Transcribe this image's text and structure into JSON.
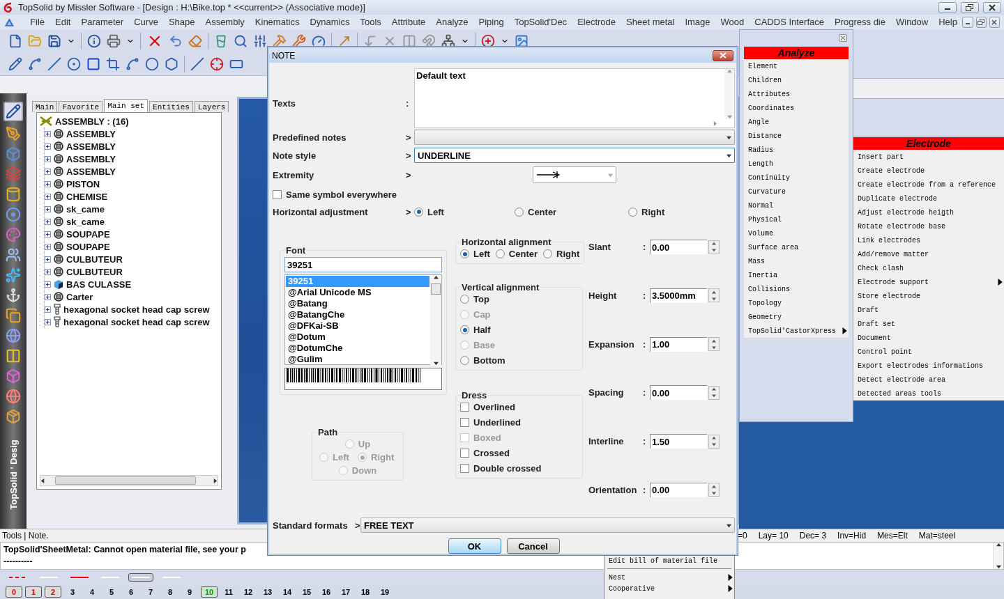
{
  "window": {
    "title": "TopSolid by Missler Software - [Design : H:\\Bike.top *  <<current>> (Associative mode)]"
  },
  "menu_bar": [
    "File",
    "Edit",
    "Parameter",
    "Curve",
    "Shape",
    "Assembly",
    "Kinematics",
    "Dynamics",
    "Tools",
    "Attribute",
    "Analyze",
    "Piping",
    "TopSolid'Dec",
    "Electrode",
    "Sheet metal",
    "Image",
    "Wood",
    "CADDS Interface",
    "Progress die",
    "Window",
    "Help"
  ],
  "sidebar_tabs": [
    {
      "label": "Main",
      "selected": false
    },
    {
      "label": "Favorite",
      "selected": false
    },
    {
      "label": "Main set",
      "selected": true
    },
    {
      "label": "Entities",
      "selected": false
    },
    {
      "label": "Layers",
      "selected": false
    }
  ],
  "side_logo": "TopSolid ' Desig",
  "tree": {
    "label": "ASSEMBLY : (16)",
    "children": [
      {
        "label": "ASSEMBLY",
        "kind": "part"
      },
      {
        "label": "ASSEMBLY",
        "kind": "part"
      },
      {
        "label": "ASSEMBLY",
        "kind": "part"
      },
      {
        "label": "ASSEMBLY",
        "kind": "part"
      },
      {
        "label": "PISTON",
        "kind": "part"
      },
      {
        "label": "CHEMISE",
        "kind": "part"
      },
      {
        "label": "sk_came",
        "kind": "part"
      },
      {
        "label": "sk_came",
        "kind": "part"
      },
      {
        "label": "SOUPAPE",
        "kind": "part"
      },
      {
        "label": "SOUPAPE",
        "kind": "part"
      },
      {
        "label": "CULBUTEUR",
        "kind": "part"
      },
      {
        "label": "CULBUTEUR",
        "kind": "part"
      },
      {
        "label": "BAS CULASSE",
        "kind": "solid"
      },
      {
        "label": "Carter",
        "kind": "part"
      },
      {
        "label": "hexagonal socket head cap screw",
        "kind": "screw"
      },
      {
        "label": "hexagonal socket head cap screw",
        "kind": "screw"
      }
    ]
  },
  "analyze_menu": {
    "title": "Analyze",
    "items": [
      {
        "label": "Element",
        "submenu": false
      },
      {
        "label": "Children",
        "submenu": false
      },
      {
        "label": "Attributes",
        "submenu": false
      },
      {
        "label": "Coordinates",
        "submenu": false
      },
      {
        "label": "Angle",
        "submenu": false
      },
      {
        "label": "Distance",
        "submenu": false
      },
      {
        "label": "Radius",
        "submenu": false
      },
      {
        "label": "Length",
        "submenu": false
      },
      {
        "label": "Continuity",
        "submenu": false
      },
      {
        "label": "Curvature",
        "submenu": false
      },
      {
        "label": "Normal",
        "submenu": false
      },
      {
        "label": "Physical",
        "submenu": false
      },
      {
        "label": "Volume",
        "submenu": false
      },
      {
        "label": "Surface area",
        "submenu": false
      },
      {
        "label": "Mass",
        "submenu": false
      },
      {
        "label": "Inertia",
        "submenu": false
      },
      {
        "label": "Collisions",
        "submenu": false
      },
      {
        "label": "Topology",
        "submenu": false
      },
      {
        "label": "Geometry",
        "submenu": false
      },
      {
        "label": "TopSolid'CastorXpress",
        "submenu": true
      }
    ]
  },
  "electrode_menu": {
    "title": "Electrode",
    "items": [
      {
        "label": "Insert part",
        "submenu": false
      },
      {
        "label": "Create electrode",
        "submenu": false
      },
      {
        "label": "Create electrode from a reference",
        "submenu": false
      },
      {
        "label": "Duplicate electrode",
        "submenu": false
      },
      {
        "label": "Adjust electrode heigth",
        "submenu": false
      },
      {
        "label": "Rotate electrode base",
        "submenu": false
      },
      {
        "label": "Link electrodes",
        "submenu": false
      },
      {
        "label": "Add/remove matter",
        "submenu": false
      },
      {
        "label": "Check clash",
        "submenu": false
      },
      {
        "label": "Electrode support",
        "submenu": true
      },
      {
        "label": "Store electrode",
        "submenu": false
      },
      {
        "label": "Draft",
        "submenu": false
      },
      {
        "label": "Draft set",
        "submenu": false
      },
      {
        "label": "Document",
        "submenu": false
      },
      {
        "label": "Control point",
        "submenu": false
      },
      {
        "label": "Export electrodes informations",
        "submenu": false
      },
      {
        "label": "Detect electrode area",
        "submenu": false
      },
      {
        "label": "Detected areas tools",
        "submenu": false
      }
    ]
  },
  "dialog": {
    "title": "NOTE",
    "texts": {
      "label": "Texts",
      "sep": ":",
      "value": "Default text"
    },
    "predefined_notes": {
      "label": "Predefined notes",
      "sep": ">"
    },
    "note_style": {
      "label": "Note style",
      "sep": ">",
      "value": "UNDERLINE"
    },
    "extremity": {
      "label": "Extremity",
      "sep": ">"
    },
    "same_symbol": {
      "label": "Same symbol everywhere",
      "checked": false
    },
    "horizontal_adjustment": {
      "label": "Horizontal adjustment",
      "sep": ">",
      "options": [
        {
          "label": "Left",
          "selected": true
        },
        {
          "label": "Center",
          "selected": false
        },
        {
          "label": "Right",
          "selected": false
        }
      ]
    },
    "font": {
      "label": "Font",
      "value": "39251",
      "options": [
        {
          "label": "39251",
          "selected": true
        },
        {
          "label": "@Arial Unicode MS",
          "selected": false
        },
        {
          "label": "@Batang",
          "selected": false
        },
        {
          "label": "@BatangChe",
          "selected": false
        },
        {
          "label": "@DFKai-SB",
          "selected": false
        },
        {
          "label": "@Dotum",
          "selected": false
        },
        {
          "label": "@DotumChe",
          "selected": false
        },
        {
          "label": "@Gulim",
          "selected": false
        }
      ]
    },
    "path": {
      "label": "Path",
      "options": [
        {
          "label": "Up",
          "selected": false,
          "disabled": true
        },
        {
          "label": "Left",
          "selected": false,
          "disabled": true
        },
        {
          "label": "Right",
          "selected": true,
          "disabled": true
        },
        {
          "label": "Down",
          "selected": false,
          "disabled": true
        }
      ]
    },
    "horizontal_alignment": {
      "label": "Horizontal alignment",
      "options": [
        {
          "label": "Left",
          "selected": true
        },
        {
          "label": "Center",
          "selected": false
        },
        {
          "label": "Right",
          "selected": false
        }
      ]
    },
    "vertical_alignment": {
      "label": "Vertical alignment",
      "options": [
        {
          "label": "Top",
          "selected": false,
          "disabled": false
        },
        {
          "label": "Cap",
          "selected": false,
          "disabled": true
        },
        {
          "label": "Half",
          "selected": true,
          "disabled": false
        },
        {
          "label": "Base",
          "selected": false,
          "disabled": true
        },
        {
          "label": "Bottom",
          "selected": false,
          "disabled": false
        }
      ]
    },
    "dress": {
      "label": "Dress",
      "options": [
        {
          "label": "Overlined",
          "checked": false,
          "disabled": false
        },
        {
          "label": "Underlined",
          "checked": false,
          "disabled": false
        },
        {
          "label": "Boxed",
          "checked": false,
          "disabled": true
        },
        {
          "label": "Crossed",
          "checked": false,
          "disabled": false
        },
        {
          "label": "Double crossed",
          "checked": false,
          "disabled": false
        }
      ]
    },
    "fields": [
      {
        "label": "Slant",
        "sep": ":",
        "value": "0.00"
      },
      {
        "label": "Height",
        "sep": ":",
        "value": "3.5000mm"
      },
      {
        "label": "Expansion",
        "sep": ":",
        "value": "1.00"
      },
      {
        "label": "Spacing",
        "sep": ":",
        "value": "0.00"
      },
      {
        "label": "Interline",
        "sep": ":",
        "value": "1.50"
      },
      {
        "label": "Orientation",
        "sep": ":",
        "value": "0.00"
      }
    ],
    "standard_formats": {
      "label": "Standard formats",
      "sep": ">",
      "value": "FREE TEXT"
    },
    "buttons": [
      {
        "label": "OK",
        "default": true
      },
      {
        "label": "Cancel",
        "default": false
      }
    ]
  },
  "status_bar": {
    "left": "Tools | Note.",
    "right": [
      "=0",
      "Lay= 10",
      "Dec= 3",
      "Inv=Hid",
      "Mes=Elt",
      "Mat=steel"
    ]
  },
  "messages": [
    "TopSolid'SheetMetal: Cannot open material file, see your p",
    "----------"
  ],
  "popup_menu": [
    {
      "label": "Edit bill of material file",
      "submenu": false
    },
    {
      "label": "Nest",
      "submenu": true
    },
    {
      "label": "Cooperative",
      "submenu": true
    }
  ],
  "line_styles": [
    {
      "color": "#ff0000",
      "dashed": true,
      "selected": false
    },
    {
      "color": "#ffffff",
      "dashed": false,
      "selected": false
    },
    {
      "color": "#ff0000",
      "dashed": false,
      "selected": false
    },
    {
      "color": "#ffffff",
      "dashed": false,
      "selected": false
    },
    {
      "color": "#ffffff",
      "dashed": false,
      "selected": true
    },
    {
      "color": "#ffffff",
      "dashed": false,
      "selected": false
    }
  ],
  "layers": [
    {
      "label": "0",
      "kind": "used"
    },
    {
      "label": "1",
      "kind": "used"
    },
    {
      "label": "2",
      "kind": "used"
    },
    {
      "label": "3",
      "kind": "empty"
    },
    {
      "label": "4",
      "kind": "empty"
    },
    {
      "label": "5",
      "kind": "empty"
    },
    {
      "label": "6",
      "kind": "empty"
    },
    {
      "label": "7",
      "kind": "empty"
    },
    {
      "label": "8",
      "kind": "empty"
    },
    {
      "label": "9",
      "kind": "empty"
    },
    {
      "label": "10",
      "kind": "current"
    },
    {
      "label": "11",
      "kind": "empty"
    },
    {
      "label": "12",
      "kind": "empty"
    },
    {
      "label": "13",
      "kind": "empty"
    },
    {
      "label": "14",
      "kind": "empty"
    },
    {
      "label": "15",
      "kind": "empty"
    },
    {
      "label": "16",
      "kind": "empty"
    },
    {
      "label": "17",
      "kind": "empty"
    },
    {
      "label": "18",
      "kind": "empty"
    },
    {
      "label": "19",
      "kind": "empty"
    }
  ]
}
